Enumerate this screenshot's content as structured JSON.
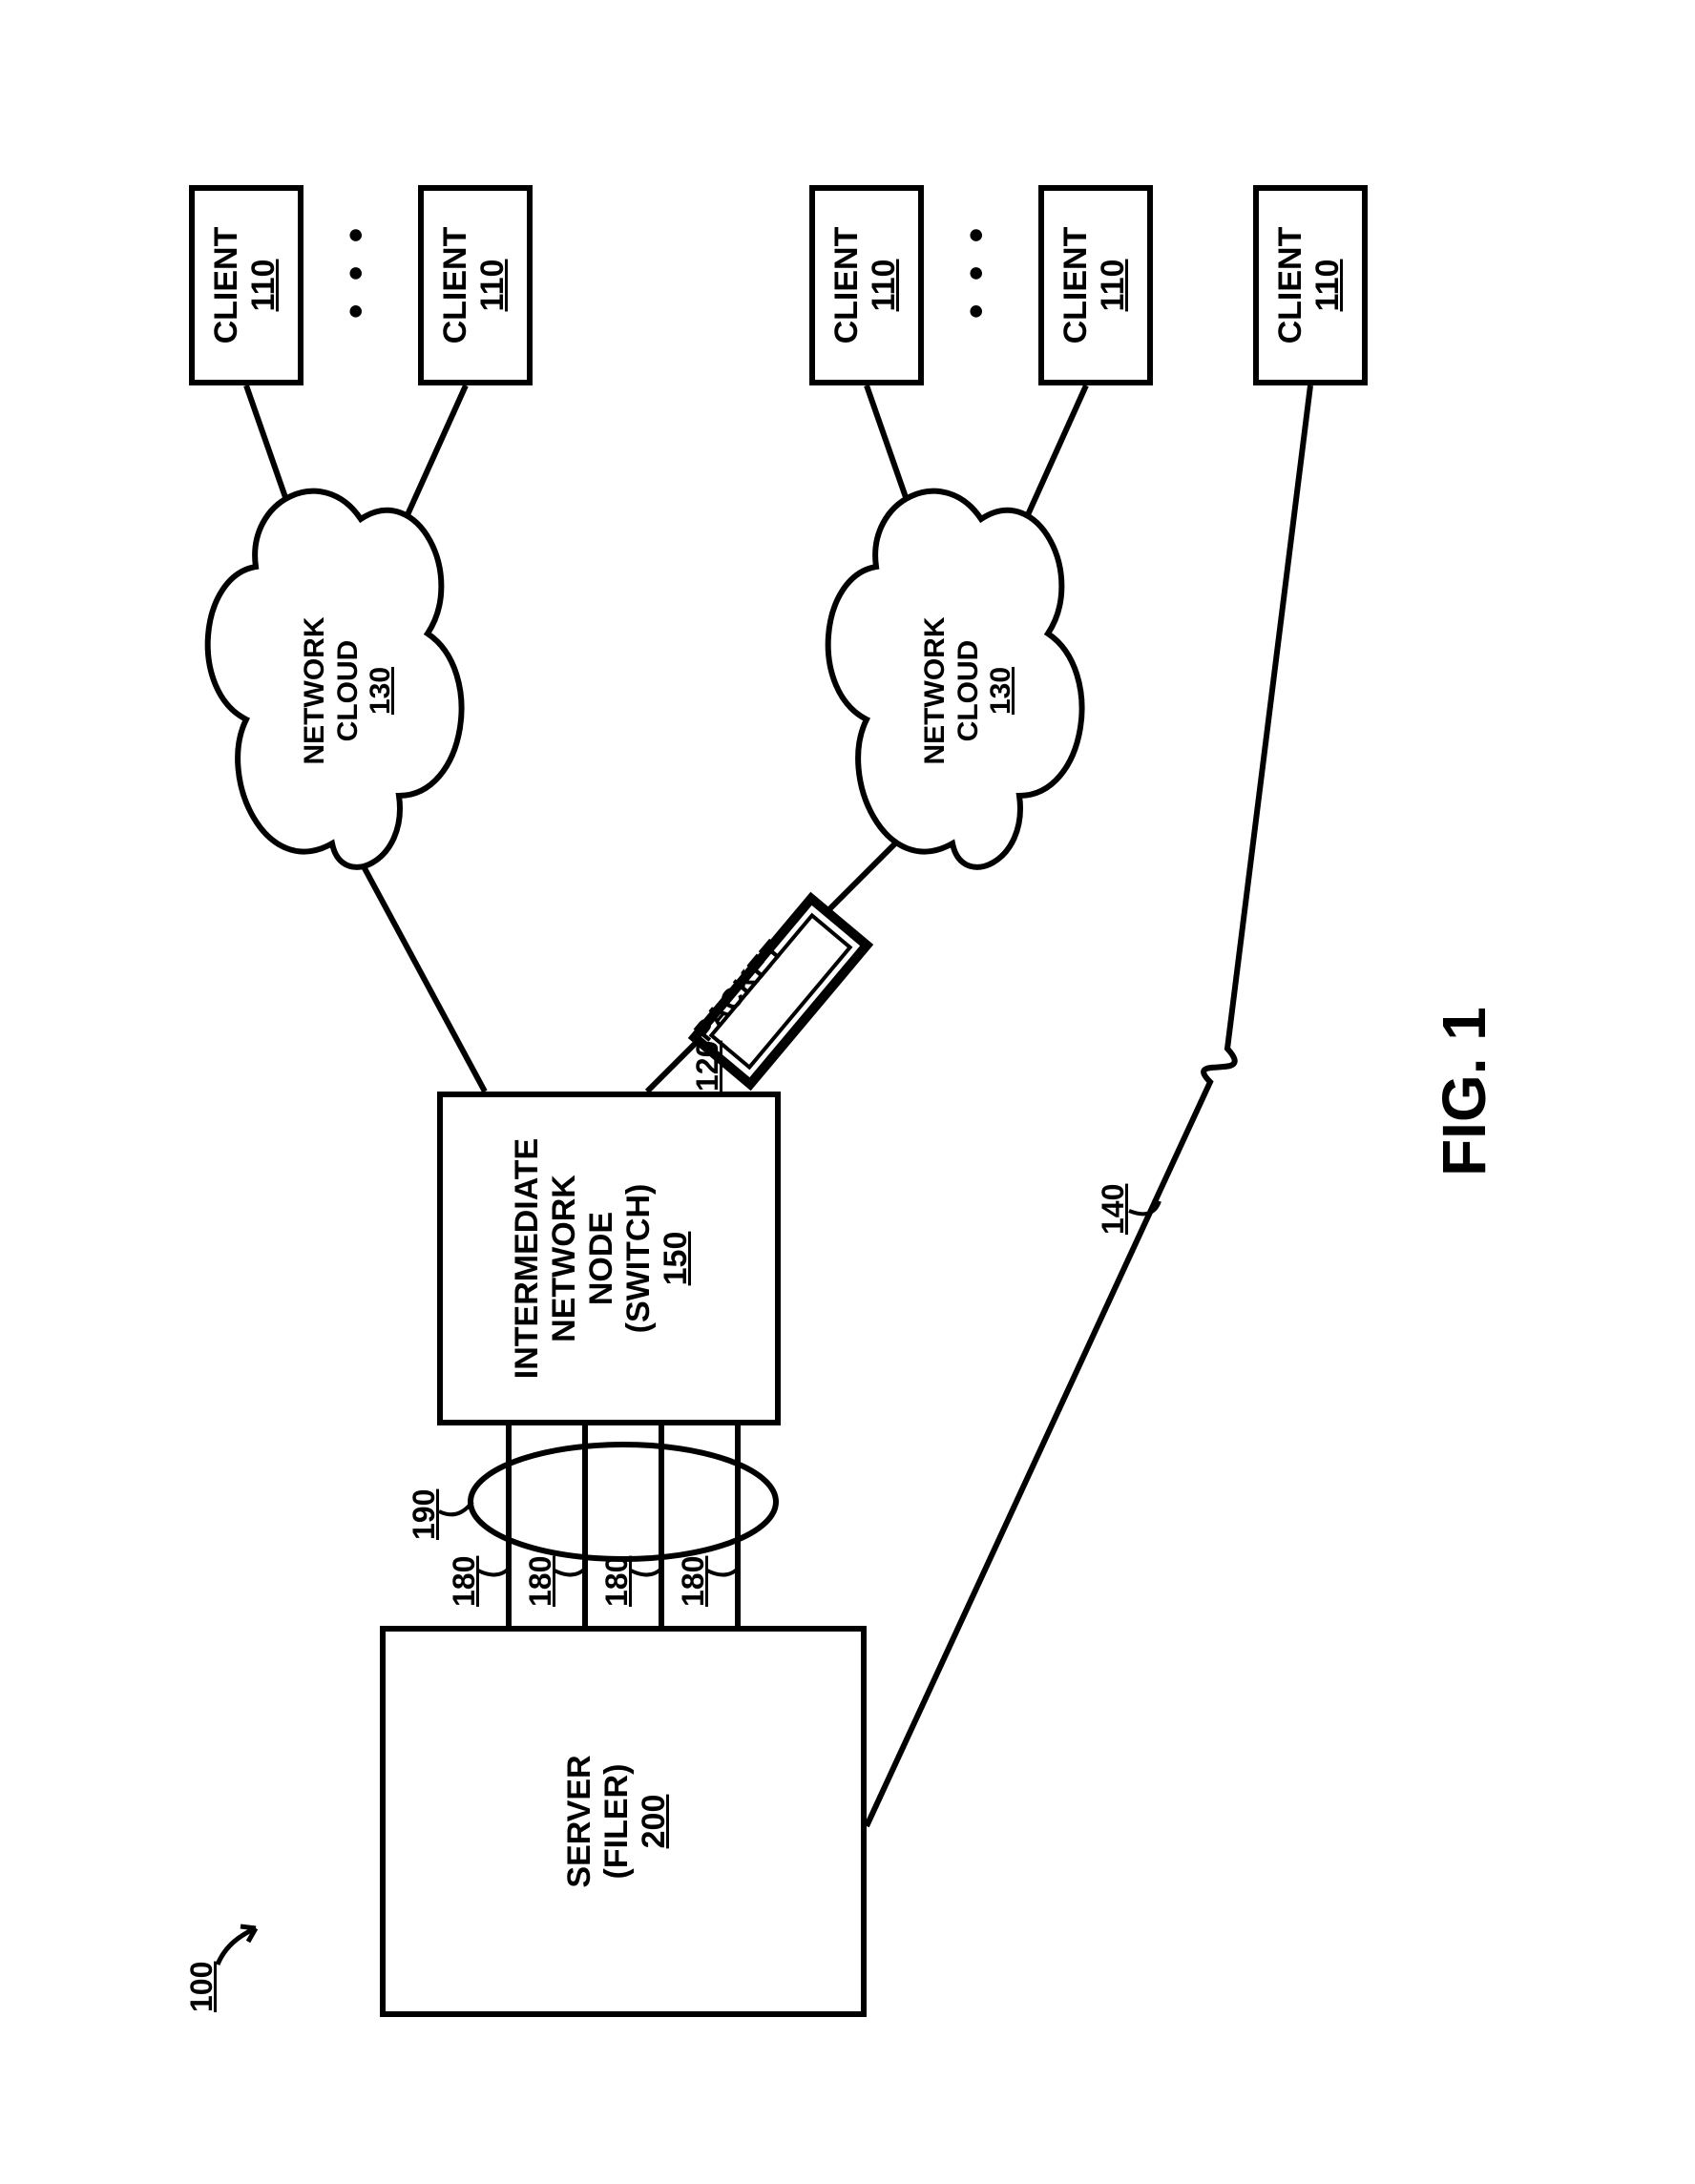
{
  "figure_ref": "100",
  "figure_label": "FIG. 1",
  "server": {
    "line1": "SERVER",
    "line2": "(FILER)",
    "ref": "200"
  },
  "switch": {
    "line1": "INTERMEDIATE",
    "line2": "NETWORK",
    "line3": "NODE",
    "line4": "(SWITCH)",
    "ref": "150"
  },
  "links": {
    "ref": "180",
    "group_ref": "190"
  },
  "packet": {
    "label": "PACKET",
    "ref": "120"
  },
  "cloud": {
    "line1": "NETWORK",
    "line2": "CLOUD",
    "ref": "130"
  },
  "client": {
    "label": "CLIENT",
    "ref": "110"
  },
  "direct_link_ref": "140"
}
